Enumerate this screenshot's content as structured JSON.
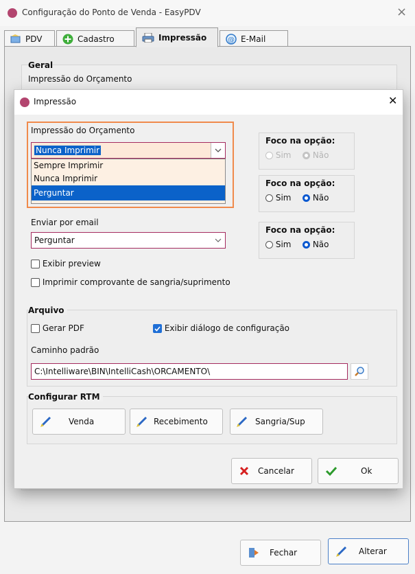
{
  "window": {
    "title": "Configuração do Ponto de Venda - EasyPDV",
    "close_glyph": "×"
  },
  "tabs": [
    {
      "label": "PDV",
      "icon": "pdv-icon"
    },
    {
      "label": "Cadastro",
      "icon": "add-icon"
    },
    {
      "label": "Impressão",
      "icon": "printer-icon"
    },
    {
      "label": "E-Mail",
      "icon": "email-icon"
    }
  ],
  "main": {
    "geral_heading": "Geral",
    "geral_label": "Impressão do Orçamento"
  },
  "dialog": {
    "title": "Impressão",
    "close_glyph": "✕",
    "orcamento": {
      "label": "Impressão do Orçamento",
      "selected": "Nunca Imprimir",
      "options": [
        "Sempre Imprimir",
        "Nunca Imprimir",
        "Perguntar"
      ],
      "highlighted": "Perguntar"
    },
    "foco1": {
      "heading": "Foco na opção:",
      "sim": "Sim",
      "nao": "Não"
    },
    "foco2": {
      "heading": "Foco na opção:",
      "sim": "Sim",
      "nao": "Não"
    },
    "foco3": {
      "heading": "Foco na opção:",
      "sim": "Sim",
      "nao": "Não"
    },
    "email": {
      "label": "Enviar por email",
      "selected": "Perguntar"
    },
    "exibir_preview": "Exibir preview",
    "imprimir_comprovante": "Imprimir comprovante de sangria/suprimento",
    "arquivo": {
      "heading": "Arquivo",
      "gerar_pdf": "Gerar PDF",
      "exibir_dialogo": "Exibir diálogo de configuração",
      "caminho_label": "Caminho padrão",
      "caminho_value": "C:\\Intelliware\\BIN\\IntelliCash\\ORCAMENTO\\"
    },
    "rtm": {
      "heading": "Configurar RTM",
      "buttons": [
        "Venda",
        "Recebimento",
        "Sangria/Sup"
      ]
    },
    "cancel_label": "Cancelar",
    "ok_label": "Ok"
  },
  "footer": {
    "fechar_label": "Fechar",
    "alterar_label": "Alterar"
  },
  "colors": {
    "accent_pink": "#a42a5e",
    "orange_highlight": "#f08a4b",
    "selection_blue": "#0b62c9"
  }
}
